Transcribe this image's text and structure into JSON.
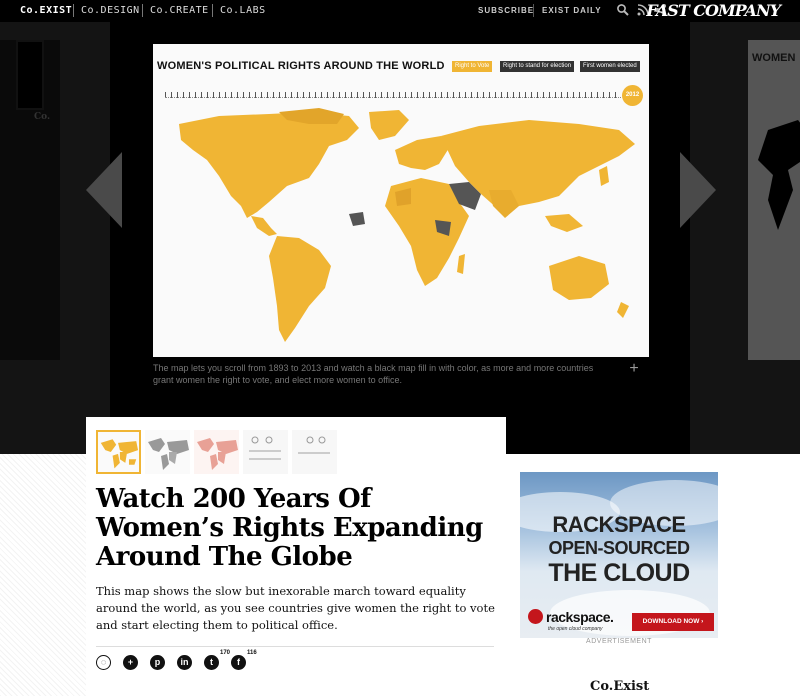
{
  "topnav": {
    "sections": [
      "Co.EXIST",
      "Co.DESIGN",
      "Co.CREATE",
      "Co.LABS"
    ],
    "links": [
      "SUBSCRIBE",
      "EXIST DAILY"
    ],
    "icons": [
      "search-icon",
      "rss-icon",
      "share-icon"
    ],
    "brand": "FAST COMPANY"
  },
  "hero": {
    "map_title": "WOMEN'S POLITICAL RIGHTS AROUND THE WORLD",
    "buttons": [
      {
        "label": "Right to Vote",
        "active": true
      },
      {
        "label": "Right to stand for election",
        "active": false
      },
      {
        "label": "First women elected",
        "active": false
      }
    ],
    "year": "2012",
    "caption": "The map lets you scroll from 1893 to 2013 and watch a black map fill in with color, as more and more countries grant women the right to vote, and elect more women to office.",
    "left_ghost_label": "Co.",
    "right_ghost_title": "WOMEN",
    "colors": {
      "map_fill": "#f0b534",
      "map_dark": "#555555",
      "accent": "#f0b534"
    }
  },
  "article": {
    "headline": "Watch 200 Years Of Women’s Rights Expanding Around The Globe",
    "dek": "This map shows the slow but inexorable march toward equality around the world, as you see countries give women the right to vote and start electing them to political office.",
    "social": [
      {
        "icon": "comment-icon",
        "count": ""
      },
      {
        "icon": "plus-icon",
        "count": ""
      },
      {
        "icon": "pinterest-icon",
        "count": ""
      },
      {
        "icon": "linkedin-icon",
        "count": ""
      },
      {
        "icon": "twitter-icon",
        "count": "170"
      },
      {
        "icon": "facebook-icon",
        "count": "116"
      }
    ]
  },
  "ad": {
    "line1": "RACKSPACE",
    "line2": "OPEN-SOURCED",
    "line3": "THE CLOUD",
    "brand": "rackspace.",
    "tagline": "the open cloud company",
    "cta": "DOWNLOAD NOW ›",
    "label": "ADVERTISEMENT"
  },
  "sidebar_label": "Co.Exist"
}
